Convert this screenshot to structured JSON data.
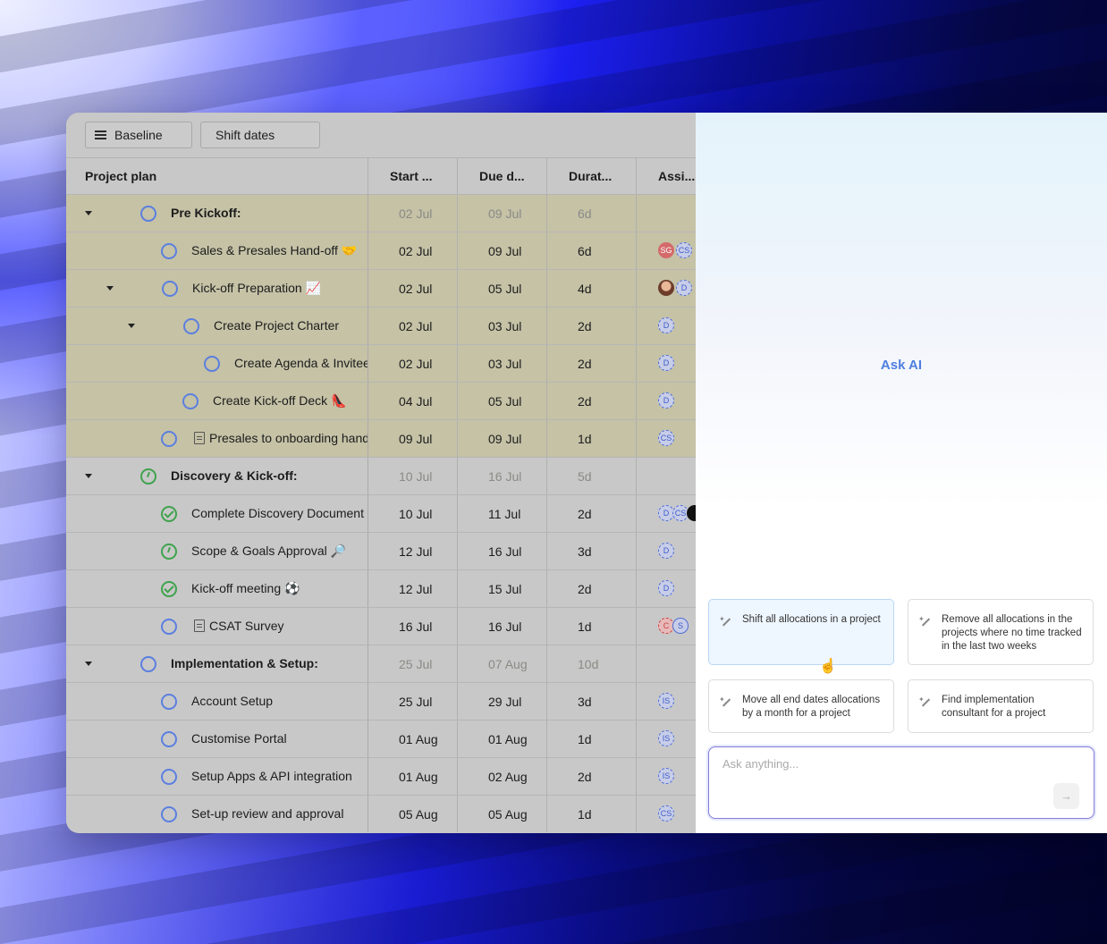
{
  "toolbar": {
    "baseline_label": "Baseline",
    "shift_dates_label": "Shift dates"
  },
  "table": {
    "headers": {
      "name": "Project plan",
      "start": "Start ...",
      "due": "Due d...",
      "duration": "Durat...",
      "assignee": "Assi..."
    },
    "rows": [
      {
        "name": "Pre Kickoff:",
        "start": "02 Jul",
        "due": "09 Jul",
        "duration": "6d"
      },
      {
        "name": "Sales & Presales Hand-off 🤝",
        "start": "02 Jul",
        "due": "09 Jul",
        "duration": "6d",
        "avatars": [
          "SG",
          "CS"
        ]
      },
      {
        "name": "Kick-off Preparation 📈",
        "start": "02 Jul",
        "due": "05 Jul",
        "duration": "4d",
        "avatars": [
          "D"
        ]
      },
      {
        "name": "Create Project Charter",
        "start": "02 Jul",
        "due": "03 Jul",
        "duration": "2d",
        "avatars": [
          "D"
        ]
      },
      {
        "name": "Create Agenda & Invitee",
        "start": "02 Jul",
        "due": "03 Jul",
        "duration": "2d",
        "avatars": [
          "D"
        ]
      },
      {
        "name": "Create Kick-off Deck 👠",
        "start": "04 Jul",
        "due": "05 Jul",
        "duration": "2d",
        "avatars": [
          "D"
        ]
      },
      {
        "name": "Presales to onboarding hand",
        "start": "09 Jul",
        "due": "09 Jul",
        "duration": "1d",
        "avatars": [
          "CS"
        ]
      },
      {
        "name": "Discovery & Kick-off:",
        "start": "10 Jul",
        "due": "16 Jul",
        "duration": "5d"
      },
      {
        "name": "Complete Discovery Document",
        "start": "10 Jul",
        "due": "11 Jul",
        "duration": "2d",
        "avatars": [
          "D",
          "CS"
        ]
      },
      {
        "name": "Scope & Goals Approval 🔎",
        "start": "12 Jul",
        "due": "16 Jul",
        "duration": "3d",
        "avatars": [
          "D"
        ]
      },
      {
        "name": "Kick-off meeting ⚽",
        "start": "12 Jul",
        "due": "15 Jul",
        "duration": "2d",
        "avatars": [
          "D"
        ]
      },
      {
        "name": "CSAT Survey",
        "start": "16 Jul",
        "due": "16 Jul",
        "duration": "1d",
        "avatars": [
          "C",
          "S"
        ]
      },
      {
        "name": "Implementation & Setup:",
        "start": "25 Jul",
        "due": "07 Aug",
        "duration": "10d"
      },
      {
        "name": "Account Setup",
        "start": "25 Jul",
        "due": "29 Jul",
        "duration": "3d",
        "avatars": [
          "IS"
        ]
      },
      {
        "name": "Customise Portal",
        "start": "01 Aug",
        "due": "01 Aug",
        "duration": "1d",
        "avatars": [
          "IS"
        ]
      },
      {
        "name": "Setup Apps & API integration",
        "start": "01 Aug",
        "due": "02 Aug",
        "duration": "2d",
        "avatars": [
          "IS"
        ]
      },
      {
        "name": "Set-up review and approval",
        "start": "05 Aug",
        "due": "05 Aug",
        "duration": "1d",
        "avatars": [
          "CS"
        ]
      }
    ]
  },
  "ai_panel": {
    "title": "Ask AI",
    "suggestions": [
      "Shift all allocations in a project",
      "Remove all allocations in the projects where no time tracked in the last two weeks",
      "Move all end dates allocations by a month for a project",
      "Find implementation consultant for a project"
    ],
    "input_placeholder": "Ask anything...",
    "send_icon": "arrow-right-icon"
  }
}
